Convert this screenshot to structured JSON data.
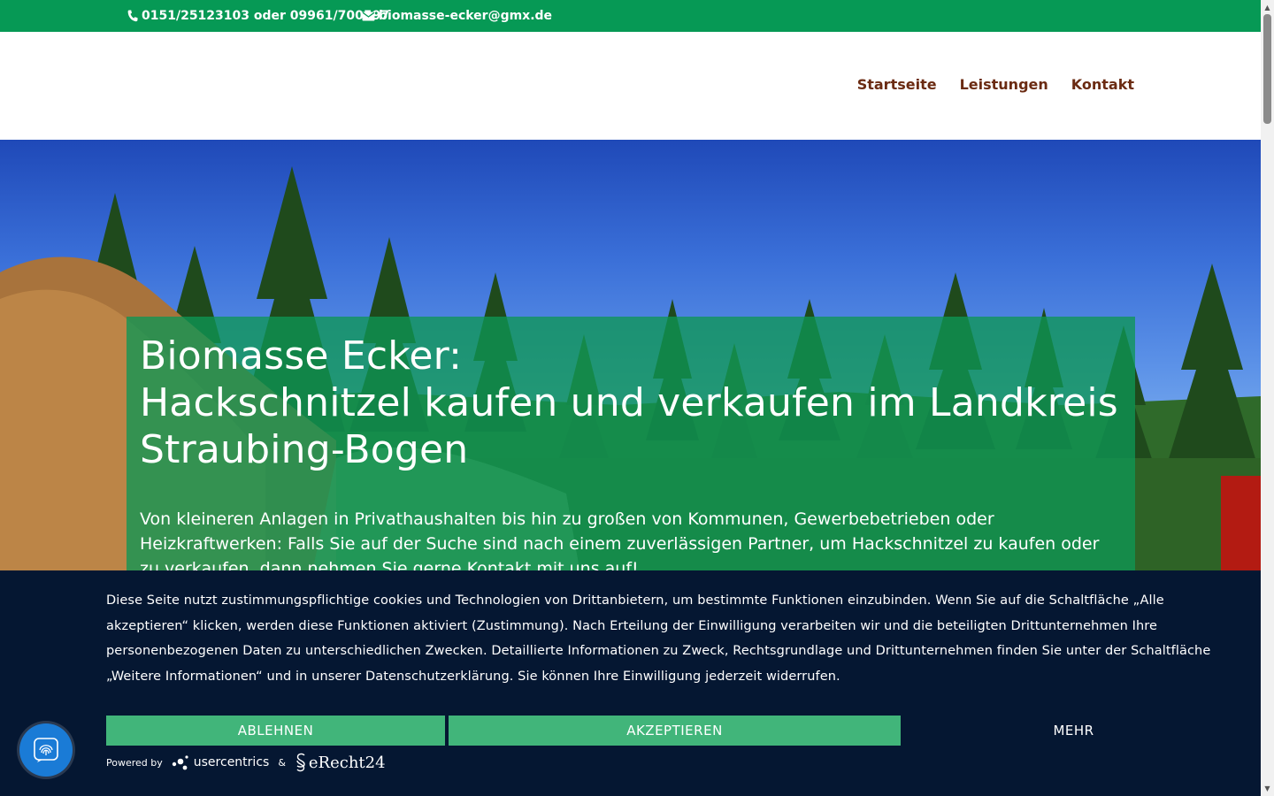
{
  "topbar": {
    "phone": "0151/25123103 oder 09961/700597",
    "email": "biomasse-ecker@gmx.de"
  },
  "nav": {
    "items": [
      "Startseite",
      "Leistungen",
      "Kontakt"
    ]
  },
  "hero": {
    "title_line1": "Biomasse Ecker:",
    "title_line2": "Hackschnitzel kaufen und verkaufen im Landkreis",
    "title_line3": "Straubing-Bogen",
    "text": "Von kleineren Anlagen in Privathaushalten bis hin zu großen von Kommunen, Gewerbebetrieben oder Heizkraftwerken: Falls Sie auf der Suche sind nach einem zuverlässigen Partner, um Hackschnitzel zu kaufen oder zu verkaufen, dann nehmen Sie gerne Kontakt mit uns auf!"
  },
  "cookie": {
    "text": "Diese Seite nutzt zustimmungspflichtige cookies und Technologien von Drittanbietern, um bestimmte Funktionen einzubinden. Wenn Sie auf die Schaltfläche „Alle akzeptieren“ klicken, werden diese Funktionen aktiviert (Zustimmung). Nach Erteilung der Einwilligung verarbeiten wir und die beteiligten Drittunternehmen Ihre personenbezogenen Daten zu unterschiedlichen Zwecken. Detaillierte Informationen zu Zweck, Rechtsgrundlage und Drittunternehmen finden Sie unter der Schaltfläche „Weitere Informationen“ und in unserer Datenschutzerklärung. Sie können Ihre Einwilligung jederzeit widerrufen.",
    "deny_label": "ABLEHNEN",
    "accept_label": "AKZEPTIEREN",
    "more_label": "MEHR",
    "powered_by": "Powered by",
    "usercentrics": "usercentrics",
    "ampersand": "&",
    "erecht": "eRecht24"
  },
  "colors": {
    "topbar_green": "#069955",
    "nav_brown": "#6b2b12",
    "banner_navy": "#051732",
    "button_green": "#41b57a",
    "fab_blue": "#1a7bd6"
  },
  "icons": {
    "phone": "phone-icon",
    "mail": "mail-icon",
    "fab": "fingerprint-icon"
  }
}
